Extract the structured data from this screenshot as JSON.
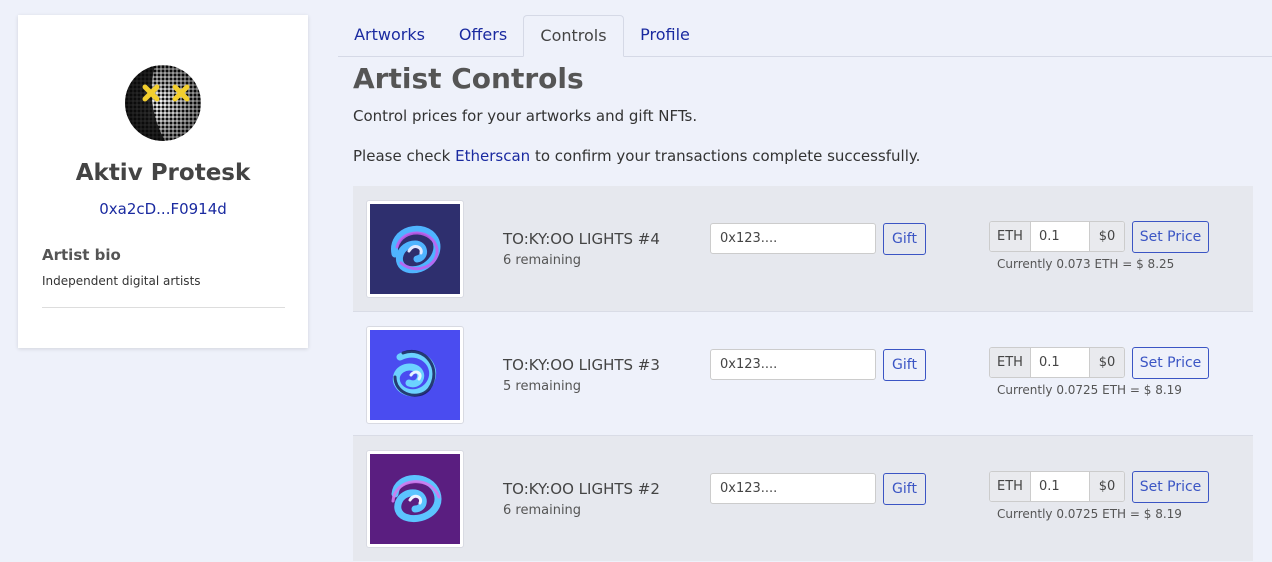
{
  "profile": {
    "name": "Aktiv Protesk",
    "address": "0xa2cD...F0914d",
    "bio_heading": "Artist bio",
    "bio_text": "Independent digital artists"
  },
  "tabs": [
    {
      "label": "Artworks",
      "active": false
    },
    {
      "label": "Offers",
      "active": false
    },
    {
      "label": "Controls",
      "active": true
    },
    {
      "label": "Profile",
      "active": false
    }
  ],
  "main": {
    "title": "Artist Controls",
    "subtitle": "Control prices for your artworks and gift NFTs.",
    "notice_prefix": "Please check ",
    "notice_link": "Etherscan",
    "notice_suffix": " to confirm your transactions complete successfully."
  },
  "artworks": [
    {
      "title": "TO:KY:OO LIGHTS #4",
      "remaining": "6 remaining",
      "gift_placeholder": "0x123....",
      "gift_label": "Gift",
      "eth_label": "ETH",
      "price_value": "0.1",
      "usd_label": "$0",
      "set_price_label": "Set Price",
      "current": "Currently 0.073 ETH = $ 8.25",
      "bg_color": "#2e2f6e"
    },
    {
      "title": "TO:KY:OO LIGHTS #3",
      "remaining": "5 remaining",
      "gift_placeholder": "0x123....",
      "gift_label": "Gift",
      "eth_label": "ETH",
      "price_value": "0.1",
      "usd_label": "$0",
      "set_price_label": "Set Price",
      "current": "Currently 0.0725 ETH = $ 8.19",
      "bg_color": "#4a4cf0"
    },
    {
      "title": "TO:KY:OO LIGHTS #2",
      "remaining": "6 remaining",
      "gift_placeholder": "0x123....",
      "gift_label": "Gift",
      "eth_label": "ETH",
      "price_value": "0.1",
      "usd_label": "$0",
      "set_price_label": "Set Price",
      "current": "Currently 0.0725 ETH = $ 8.19",
      "bg_color": "#5a1e80"
    }
  ],
  "colors": {
    "link": "#1a2aa0",
    "button": "#3b55c4",
    "page_bg": "#eef1fa"
  }
}
